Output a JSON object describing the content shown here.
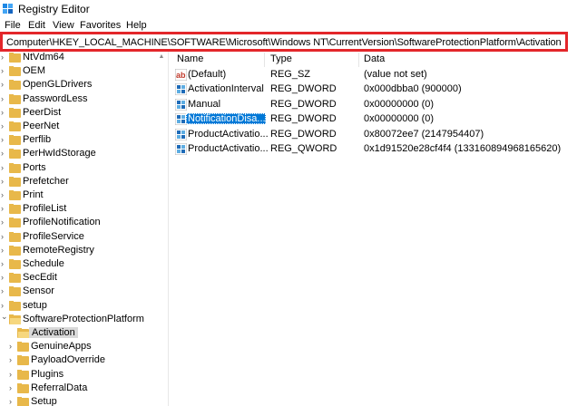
{
  "window": {
    "title": "Registry Editor"
  },
  "menu": [
    "File",
    "Edit",
    "View",
    "Favorites",
    "Help"
  ],
  "address": "Computer\\HKEY_LOCAL_MACHINE\\SOFTWARE\\Microsoft\\Windows NT\\CurrentVersion\\SoftwareProtectionPlatform\\Activation",
  "tree": [
    {
      "label": "NtVdm64",
      "expanded": false
    },
    {
      "label": "OEM",
      "expanded": false
    },
    {
      "label": "OpenGLDrivers",
      "expanded": false
    },
    {
      "label": "PasswordLess",
      "expanded": false
    },
    {
      "label": "PeerDist",
      "expanded": false
    },
    {
      "label": "PeerNet",
      "expanded": false
    },
    {
      "label": "Perflib",
      "expanded": false
    },
    {
      "label": "PerHwIdStorage",
      "expanded": false
    },
    {
      "label": "Ports",
      "expanded": false
    },
    {
      "label": "Prefetcher",
      "expanded": false
    },
    {
      "label": "Print",
      "expanded": false
    },
    {
      "label": "ProfileList",
      "expanded": false
    },
    {
      "label": "ProfileNotification",
      "expanded": false
    },
    {
      "label": "ProfileService",
      "expanded": false
    },
    {
      "label": "RemoteRegistry",
      "expanded": false
    },
    {
      "label": "Schedule",
      "expanded": false
    },
    {
      "label": "SecEdit",
      "expanded": false
    },
    {
      "label": "Sensor",
      "expanded": false
    },
    {
      "label": "setup",
      "expanded": false
    },
    {
      "label": "SoftwareProtectionPlatform",
      "expanded": true
    },
    {
      "label": "Activation",
      "expanded": false,
      "child": true,
      "selected": true
    },
    {
      "label": "GenuineApps",
      "expanded": false,
      "child": true
    },
    {
      "label": "PayloadOverride",
      "expanded": false,
      "child": true
    },
    {
      "label": "Plugins",
      "expanded": false,
      "child": true
    },
    {
      "label": "ReferralData",
      "expanded": false,
      "child": true
    },
    {
      "label": "Setup",
      "expanded": false,
      "child": true
    }
  ],
  "columns": {
    "name": "Name",
    "type": "Type",
    "data": "Data"
  },
  "values": [
    {
      "name": "(Default)",
      "type": "REG_SZ",
      "data": "(value not set)",
      "icon": "string-value-icon"
    },
    {
      "name": "ActivationInterval",
      "type": "REG_DWORD",
      "data": "0x000dbba0 (900000)",
      "icon": "binary-value-icon"
    },
    {
      "name": "Manual",
      "type": "REG_DWORD",
      "data": "0x00000000 (0)",
      "icon": "binary-value-icon"
    },
    {
      "name": "NotificationDisa...",
      "type": "REG_DWORD",
      "data": "0x00000000 (0)",
      "icon": "binary-value-icon",
      "selected": true
    },
    {
      "name": "ProductActivatio...",
      "type": "REG_DWORD",
      "data": "0x80072ee7 (2147954407)",
      "icon": "binary-value-icon"
    },
    {
      "name": "ProductActivatio...",
      "type": "REG_QWORD",
      "data": "0x1d91520e28cf4f4 (133160894968165620)",
      "icon": "binary-value-icon"
    }
  ],
  "colors": {
    "highlight": "#e3262a",
    "selection": "#0078d7",
    "folder": "#e8b84a"
  }
}
